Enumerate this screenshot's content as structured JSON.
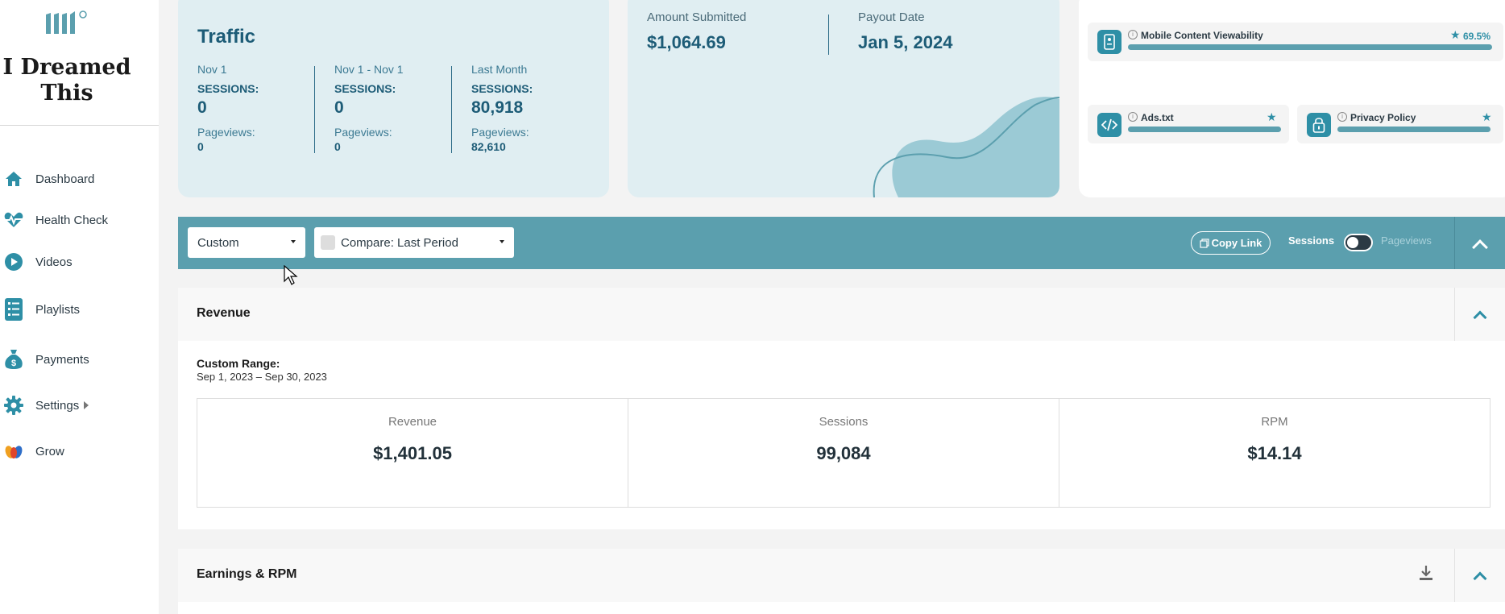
{
  "sidebar": {
    "logo_text": "I Dreamed This",
    "logo_line1": "I Dreamed",
    "logo_line2": "This",
    "items": [
      {
        "label": "Dashboard",
        "icon": "home-icon"
      },
      {
        "label": "Health Check",
        "icon": "heartbeat-icon"
      },
      {
        "label": "Videos",
        "icon": "play-icon"
      },
      {
        "label": "Playlists",
        "icon": "list-icon"
      },
      {
        "label": "Payments",
        "icon": "money-bag-icon"
      },
      {
        "label": "Settings",
        "icon": "gear-icon"
      },
      {
        "label": "Grow",
        "icon": "grow-icon"
      }
    ]
  },
  "traffic": {
    "title": "Traffic",
    "columns": [
      {
        "period": "Nov 1",
        "sessions_label": "SESSIONS:",
        "sessions": "0",
        "pageviews_label": "Pageviews:",
        "pageviews": "0"
      },
      {
        "period": "Nov 1 - Nov 1",
        "sessions_label": "SESSIONS:",
        "sessions": "0",
        "pageviews_label": "Pageviews:",
        "pageviews": "0"
      },
      {
        "period": "Last Month",
        "sessions_label": "SESSIONS:",
        "sessions": "80,918",
        "pageviews_label": "Pageviews:",
        "pageviews": "82,610"
      }
    ]
  },
  "payout": {
    "amount_label": "Amount Submitted",
    "amount": "$1,064.69",
    "date_label": "Payout Date",
    "date": "Jan 5, 2024"
  },
  "health": {
    "items": [
      {
        "name": "Mobile Content Viewability",
        "score": "69.5%",
        "icon": "mobile-icon"
      },
      {
        "name": "Ads.txt",
        "icon": "code-icon"
      },
      {
        "name": "Privacy Policy",
        "icon": "lock-icon"
      }
    ]
  },
  "filters": {
    "range_select": "Custom",
    "compare_select": "Compare: Last Period",
    "copy_link": "Copy Link",
    "toggle_left": "Sessions",
    "toggle_right": "Pageviews"
  },
  "revenue": {
    "title": "Revenue",
    "range_label": "Custom Range:",
    "range_value": "Sep 1, 2023 – Sep 30, 2023",
    "stats": [
      {
        "label": "Revenue",
        "value": "$1,401.05"
      },
      {
        "label": "Sessions",
        "value": "99,084"
      },
      {
        "label": "RPM",
        "value": "$14.14"
      }
    ]
  },
  "earnings": {
    "title": "Earnings & RPM"
  },
  "colors": {
    "accent": "#5b9fae",
    "dark_teal": "#1d5c77",
    "icon_teal": "#2e8fa6",
    "card_bg": "#e0eef2"
  }
}
